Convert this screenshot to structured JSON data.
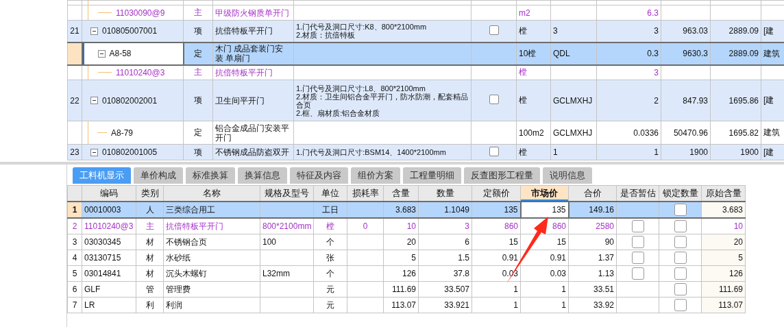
{
  "bill": {
    "rows_continued": [
      {
        "kind": "material",
        "code": "11030090@9",
        "type": "主",
        "name": "甲级防火钢质单开门",
        "unit": "m2",
        "quantity": "6.3",
        "selected": false
      }
    ],
    "rows": [
      {
        "kind": "item",
        "num": "21",
        "code": "010805007001",
        "type": "项",
        "name": "抗倍特板平开门",
        "features": [
          "1.门代号及洞口尺寸:K8、800*2100mm",
          "2.材质：抗倍特板"
        ],
        "checked": false,
        "unit": "樘",
        "expression": "3",
        "quantity": "3",
        "price": "963.03",
        "total": "2889.09",
        "column_12": "[建",
        "selected": false,
        "expanded": true,
        "children": [
          {
            "kind": "quota",
            "code": "A8-58",
            "type": "定",
            "name": "木门 成品套装门安装 单扇门",
            "unit": "10樘",
            "expression": "QDL",
            "quantity": "0.3",
            "price": "9630.3",
            "total": "2889.09",
            "column_12": "建筑",
            "selected": true,
            "expanded": true,
            "children": [
              {
                "kind": "material",
                "code": "11010240@3",
                "type": "主",
                "name": "抗倍特板平开门",
                "unit": "樘",
                "quantity": "3",
                "selected": false
              }
            ]
          }
        ]
      },
      {
        "kind": "item",
        "num": "22",
        "code": "010802002001",
        "type": "项",
        "name": "卫生间平开门",
        "features": [
          "1.门代号及洞口尺寸:L8、800*2100mm",
          "2.材质：卫生间铝合金平开门，防水防潮，配套精品合页",
          "2.框、扇材质:铝合金材质"
        ],
        "checked": false,
        "unit": "樘",
        "expression": "GCLMXHJ",
        "quantity": "2",
        "price": "847.93",
        "total": "1695.86",
        "column_12": "[建",
        "selected": false,
        "expanded": true,
        "children": [
          {
            "kind": "quota",
            "code": "A8-79",
            "type": "定",
            "name": "铝合金成品门安装平开门",
            "unit": "100m2",
            "expression": "GCLMXHJ",
            "quantity": "0.0336",
            "price": "50470.96",
            "total": "1695.82",
            "column_12": "建筑",
            "selected": false
          }
        ]
      },
      {
        "kind": "item",
        "num": "23",
        "code": "010802001005",
        "type": "项",
        "name": "不锈钢成品防盗双开",
        "features": [
          "1.门代号及洞口尺寸:BSM14、1400*2100mm"
        ],
        "checked": false,
        "unit": "樘",
        "expression": "1",
        "quantity": "1",
        "price": "1900",
        "total": "1900",
        "column_12": "[建",
        "selected": false,
        "expanded": true
      }
    ]
  },
  "tabs": [
    {
      "label": "工料机显示",
      "selected": true
    },
    {
      "label": "单价构成",
      "selected": false
    },
    {
      "label": "标准换算",
      "selected": false
    },
    {
      "label": "换算信息",
      "selected": false
    },
    {
      "label": "特征及内容",
      "selected": false
    },
    {
      "label": "组价方案",
      "selected": false
    },
    {
      "label": "工程量明细",
      "selected": false
    },
    {
      "label": "反查图形工程量",
      "selected": false
    },
    {
      "label": "说明信息",
      "selected": false
    }
  ],
  "resources": {
    "columns": [
      {
        "label": "编码",
        "selected": false
      },
      {
        "label": "类别",
        "selected": false
      },
      {
        "label": "名称",
        "selected": false
      },
      {
        "label": "规格及型号",
        "selected": false
      },
      {
        "label": "单位",
        "selected": false
      },
      {
        "label": "损耗率",
        "selected": false
      },
      {
        "label": "含量",
        "selected": false
      },
      {
        "label": "数量",
        "selected": false
      },
      {
        "label": "定额价",
        "selected": false
      },
      {
        "label": "市场价",
        "selected": true
      },
      {
        "label": "合价",
        "selected": false
      },
      {
        "label": "是否暂估",
        "selected": false
      },
      {
        "label": "锁定数量",
        "selected": false
      },
      {
        "label": "原始含量",
        "selected": false
      }
    ],
    "rows": [
      {
        "kind": "labor",
        "num": "1",
        "code": "00010003",
        "category": "人",
        "name": "三类综合用工",
        "unit": "工日",
        "content": "3.683",
        "quantity": "1.1049",
        "quota_price": "135",
        "market_price": "135",
        "total": "149.16",
        "lock_quantity": false,
        "original_content": "3.683",
        "selected": true
      },
      {
        "kind": "main",
        "num": "2",
        "code": "11010240@3",
        "category": "主",
        "name": "抗倍特板平开门",
        "spec": "800*2100mm",
        "unit": "樘",
        "loss_rate": "0",
        "content": "10",
        "quantity": "3",
        "quota_price": "860",
        "market_price": "860",
        "total": "2580",
        "estimate": false,
        "lock_quantity": false,
        "original_content": "10",
        "selected": false
      },
      {
        "kind": "material",
        "num": "3",
        "code": "03030345",
        "category": "材",
        "name": "不锈钢合页",
        "spec": "100",
        "unit": "个",
        "content": "20",
        "quantity": "6",
        "quota_price": "15",
        "market_price": "15",
        "total": "90",
        "estimate": false,
        "lock_quantity": false,
        "original_content": "20",
        "selected": false
      },
      {
        "kind": "material",
        "num": "4",
        "code": "03130715",
        "category": "材",
        "name": "水砂纸",
        "unit": "张",
        "content": "5",
        "quantity": "1.5",
        "quota_price": "0.91",
        "market_price": "0.91",
        "total": "1.37",
        "estimate": false,
        "lock_quantity": false,
        "original_content": "5",
        "selected": false
      },
      {
        "kind": "material",
        "num": "5",
        "code": "03014841",
        "category": "材",
        "name": "沉头木螺钉",
        "spec": "L32mm",
        "unit": "个",
        "content": "126",
        "quantity": "37.8",
        "quota_price": "0.03",
        "market_price": "0.03",
        "total": "1.13",
        "estimate": false,
        "lock_quantity": false,
        "original_content": "126",
        "selected": false
      },
      {
        "kind": "fee",
        "num": "6",
        "code": "GLF",
        "category": "管",
        "name": "管理费",
        "unit": "元",
        "content": "111.69",
        "quantity": "33.507",
        "quota_price": "1",
        "market_price": "1",
        "total": "33.51",
        "lock_quantity": false,
        "original_content": "111.69",
        "selected": false
      },
      {
        "kind": "fee",
        "num": "7",
        "code": "LR",
        "category": "利",
        "name": "利润",
        "unit": "元",
        "content": "113.07",
        "quantity": "33.921",
        "quota_price": "1",
        "market_price": "1",
        "total": "33.92",
        "lock_quantity": false,
        "original_content": "113.07",
        "selected": false
      }
    ]
  }
}
